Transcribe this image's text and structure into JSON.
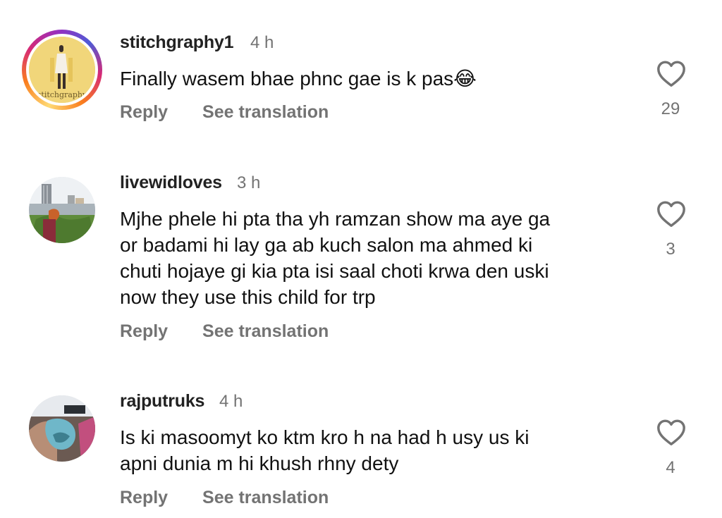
{
  "comments": [
    {
      "username": "stitchgraphy1",
      "time": "4 h",
      "text_lines": [
        "Finally wasem bhae phnc gae is k pas😂"
      ],
      "reply_label": "Reply",
      "translation_label": "See translation",
      "likes": "29",
      "avatar_text": "stitchgraphy",
      "avatar_has_story": true
    },
    {
      "username": "livewidloves",
      "time": "3 h",
      "text_lines": [
        "Mjhe phele hi pta tha yh ramzan show ma aye ga",
        "or badami hi lay ga ab kuch salon ma ahmed ki",
        "chuti hojaye gi kia pta isi saal choti krwa den uski",
        "now they use this child for trp"
      ],
      "reply_label": "Reply",
      "translation_label": "See translation",
      "likes": "3",
      "avatar_has_story": false
    },
    {
      "username": "rajputruks",
      "time": "4 h",
      "text_lines": [
        "Is ki masoomyt ko ktm kro h na had h usy us ki",
        "apni dunia m hi khush rhny dety"
      ],
      "reply_label": "Reply",
      "translation_label": "See translation",
      "likes": "4",
      "avatar_has_story": false
    }
  ],
  "colors": {
    "text": "#111111",
    "secondary": "#737373",
    "story_ring": [
      "#feda75",
      "#fa7e1e",
      "#d62976",
      "#962fbf"
    ]
  },
  "icons": {
    "like": "heart-outline-icon"
  }
}
